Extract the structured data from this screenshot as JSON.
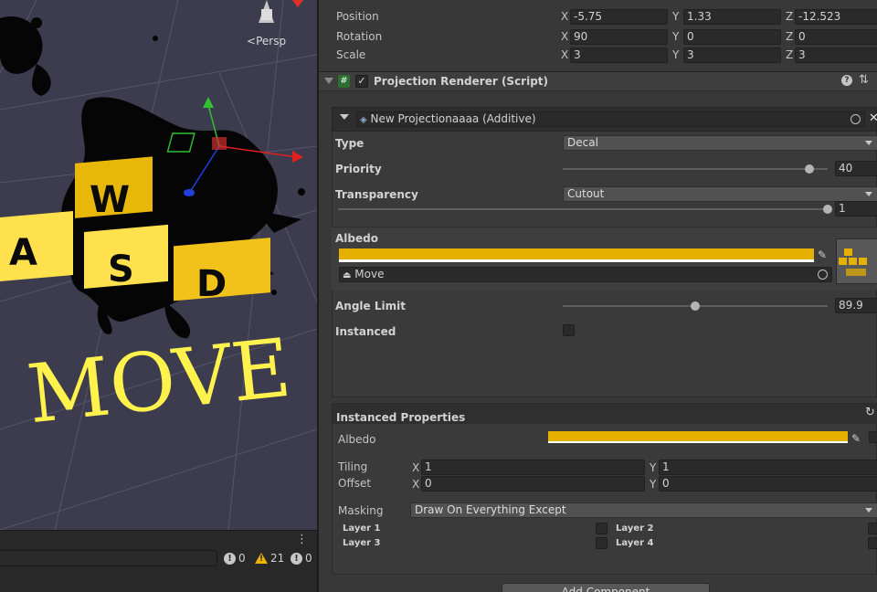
{
  "scene": {
    "persp_label": "Persp",
    "decal_letters": [
      "W",
      "A",
      "S",
      "D"
    ],
    "handwriting": "MOVE"
  },
  "console": {
    "menu_glyph": "⋮",
    "info_count": "0",
    "warning_count": "21",
    "error_count": "0"
  },
  "transform": {
    "position": {
      "label": "Position",
      "x": "-5.75",
      "y": "1.33",
      "z": "-12.523"
    },
    "rotation": {
      "label": "Rotation",
      "x": "90",
      "y": "0",
      "z": "0"
    },
    "scale": {
      "label": "Scale",
      "x": "3",
      "y": "3",
      "z": "3"
    },
    "axis_x": "X",
    "axis_y": "Y",
    "axis_z": "Z"
  },
  "component": {
    "title": "Projection Renderer (Script)",
    "enabled": true
  },
  "projection": {
    "material_name": "New Projectionaaaa (Additive)",
    "type_label": "Type",
    "type_value": "Decal",
    "priority_label": "Priority",
    "priority_value": "40",
    "priority_fraction": 0.93,
    "transparency_label": "Transparency",
    "transparency_value": "Cutout",
    "cutoff_value": "1",
    "cutoff_fraction": 1.0,
    "albedo_label": "Albedo",
    "albedo_color": "#e6b000",
    "texture_name": "Move",
    "angle_label": "Angle Limit",
    "angle_value": "89.9",
    "angle_fraction": 0.5,
    "instanced_label": "Instanced"
  },
  "instanced_properties": {
    "title": "Instanced Properties",
    "albedo_label": "Albedo",
    "albedo_color": "#e6b000",
    "tiling_label": "Tiling",
    "tiling_x": "1",
    "tiling_y": "1",
    "offset_label": "Offset",
    "offset_x": "0",
    "offset_y": "0",
    "masking_label": "Masking",
    "masking_value": "Draw On Everything Except",
    "layers": [
      "Layer 1",
      "Layer 2",
      "Layer 3",
      "Layer 4"
    ]
  },
  "add_component_label": "Add Component",
  "colors": {
    "accent_yellow": "#e6b000",
    "panel_bg": "#383838",
    "scene_bg": "#3c3c4e",
    "warning": "#f0b400"
  }
}
